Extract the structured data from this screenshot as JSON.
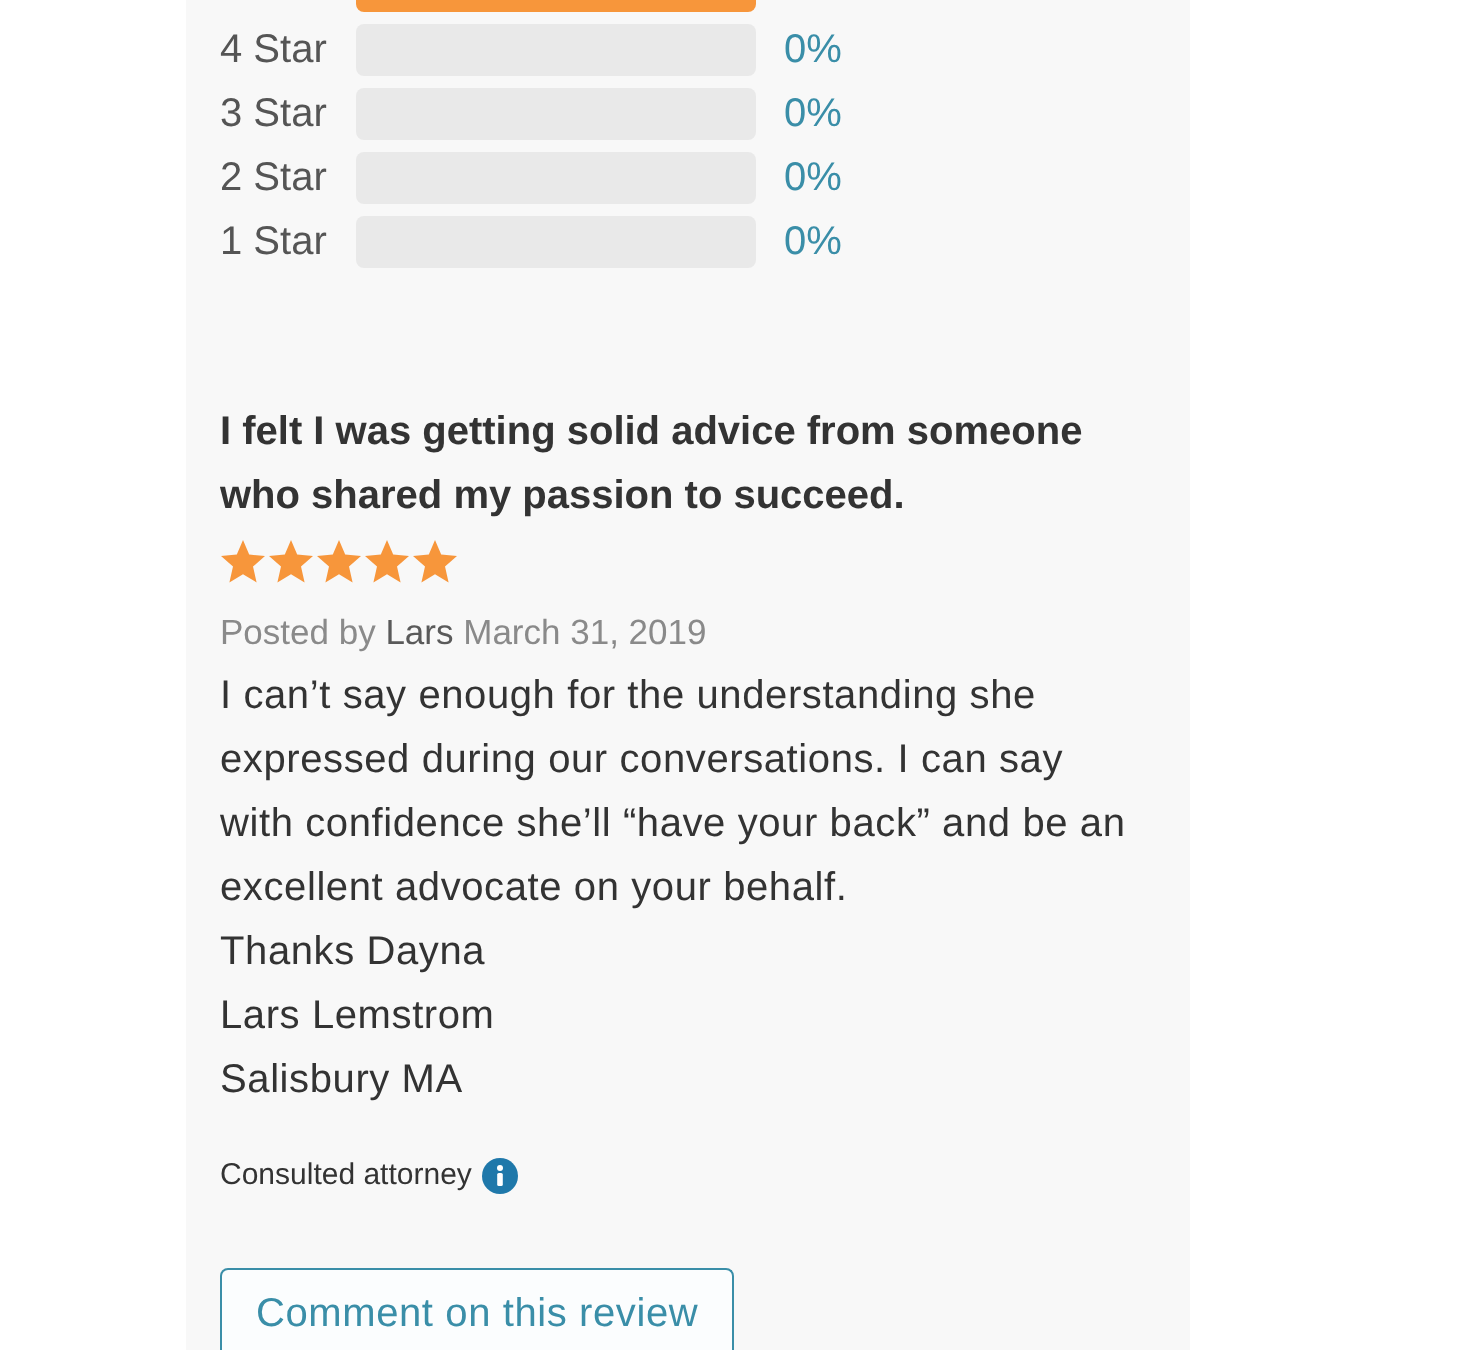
{
  "rating_breakdown": [
    {
      "level": 1
    },
    {
      "label": "4 Star",
      "level": 0,
      "percent": "0%"
    },
    {
      "label": "3 Star",
      "level": 0,
      "percent": "0%"
    },
    {
      "label": "2 Star",
      "level": 0,
      "percent": "0%"
    },
    {
      "label": "1 Star",
      "level": 0,
      "percent": "0%"
    }
  ],
  "review": {
    "title": "I felt I was getting solid advice from someone who shared my passion to succeed.",
    "stars": 5,
    "posted_by": "Posted by",
    "author": "Lars",
    "date": "March 31, 2019",
    "body": "I can’t say enough for the understanding she expressed during our conversations. I can say with confidence she’ll “have your back” and be an excellent advocate on your behalf.",
    "signature": [
      "Thanks Dayna",
      "Lars Lemstrom",
      "Salisbury MA"
    ],
    "consulted": "Consulted attorney"
  },
  "comment_button": "Comment on this review"
}
